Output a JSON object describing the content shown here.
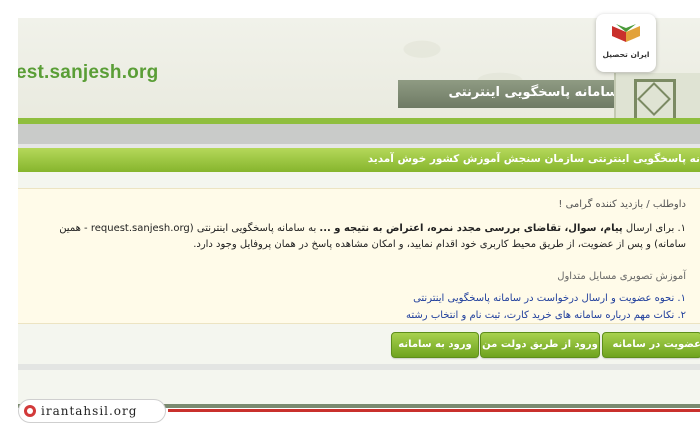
{
  "header": {
    "site_url": "est.sanjesh.org",
    "system_title": "سامانه پاسخگویی اینترنتی"
  },
  "welcome": {
    "text": "نه پاسخگویی اینترنتی سازمان سنجش آموزش کشور خوش آمدید"
  },
  "content": {
    "greeting": "داوطلب / بازدید کننده گرامی !",
    "para_part1": "۱. برای ارسال ",
    "para_bold": "پیام، سوال، تقاضای بررسی مجدد نمره، اعتراض به نتیجه و ...",
    "para_part2": " به سامانه پاسخگویی اینترنتی (request.sanjesh.org - همین سامانه) و پس از عضویت، از طریق محیط کاربری خود اقدام نمایید، و امکان مشاهده پاسخ در همان پروفایل وجود دارد.",
    "tutorials_title": "آموزش تصویری مسایل متداول",
    "links": [
      "۱. نحوه عضویت و ارسال درخواست در سامانه پاسخگویی اینترنتی",
      "۲. نکات مهم درباره سامانه های خرید کارت، ثبت نام و انتخاب رشته"
    ]
  },
  "buttons": {
    "login": "ورود به سامانه",
    "login_gov": "ورود از طریق دولت من",
    "register": "عضویت در سامانه"
  },
  "watermark": {
    "text": "irantahsil.org"
  },
  "logo": {
    "text": "ایران تحصیل"
  },
  "colors": {
    "accent_green": "#86b52d",
    "link_blue": "#1f3e9c",
    "brand_red": "#c9302c"
  }
}
